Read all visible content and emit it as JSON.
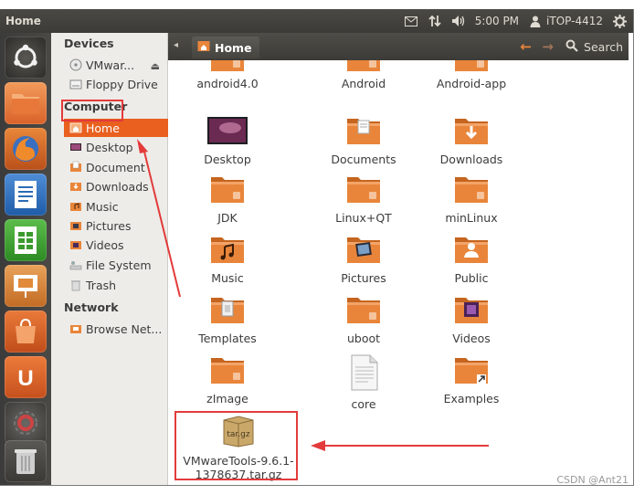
{
  "panel": {
    "title": "Home",
    "time": "5:00 PM",
    "user": "iTOP-4412",
    "icons": [
      "mail-icon",
      "network-icon",
      "volume-icon",
      "user-icon",
      "gear-icon"
    ]
  },
  "launcher": {
    "items": [
      "dash-home-icon",
      "files-icon",
      "firefox-icon",
      "writer-icon",
      "calc-icon",
      "impress-icon",
      "software-center-icon",
      "ubuntu-one-icon",
      "system-settings-icon",
      "trash-icon"
    ]
  },
  "sidebar": {
    "devices_heading": "Devices",
    "devices": [
      "VMwar...",
      "Floppy Drive"
    ],
    "computer_heading": "Computer",
    "computer": [
      "Home",
      "Desktop",
      "Document",
      "Downloads",
      "Music",
      "Pictures",
      "Videos",
      "File System",
      "Trash"
    ],
    "network_heading": "Network",
    "network": [
      "Browse Net..."
    ]
  },
  "toolbar": {
    "location": "Home",
    "search_label": "Search"
  },
  "files": [
    {
      "name": "android4.0",
      "kind": "folder"
    },
    {
      "name": "Android",
      "kind": "folder"
    },
    {
      "name": "Android-app",
      "kind": "folder"
    },
    {
      "name": "Desktop",
      "kind": "desktop"
    },
    {
      "name": "Documents",
      "kind": "folder-docs"
    },
    {
      "name": "Downloads",
      "kind": "folder-down"
    },
    {
      "name": "JDK",
      "kind": "folder"
    },
    {
      "name": "Linux+QT",
      "kind": "folder"
    },
    {
      "name": "minLinux",
      "kind": "folder"
    },
    {
      "name": "Music",
      "kind": "folder-music"
    },
    {
      "name": "Pictures",
      "kind": "folder-pictures"
    },
    {
      "name": "Public",
      "kind": "folder-public"
    },
    {
      "name": "Templates",
      "kind": "folder-templates"
    },
    {
      "name": "uboot",
      "kind": "folder"
    },
    {
      "name": "Videos",
      "kind": "folder-videos"
    },
    {
      "name": "zImage",
      "kind": "folder"
    },
    {
      "name": "core",
      "kind": "document"
    },
    {
      "name": "Examples",
      "kind": "folder-link"
    }
  ],
  "archive": {
    "badge": "tar.gz",
    "line1": "VMwareTools-9.6.1-",
    "line2": "1378637.tar.gz"
  },
  "watermark": "CSDN @Ant21",
  "colors": {
    "accent": "#e9601f",
    "panel": "#3c3b37",
    "annotation": "#e33b3b",
    "folder": "#e9853a"
  }
}
